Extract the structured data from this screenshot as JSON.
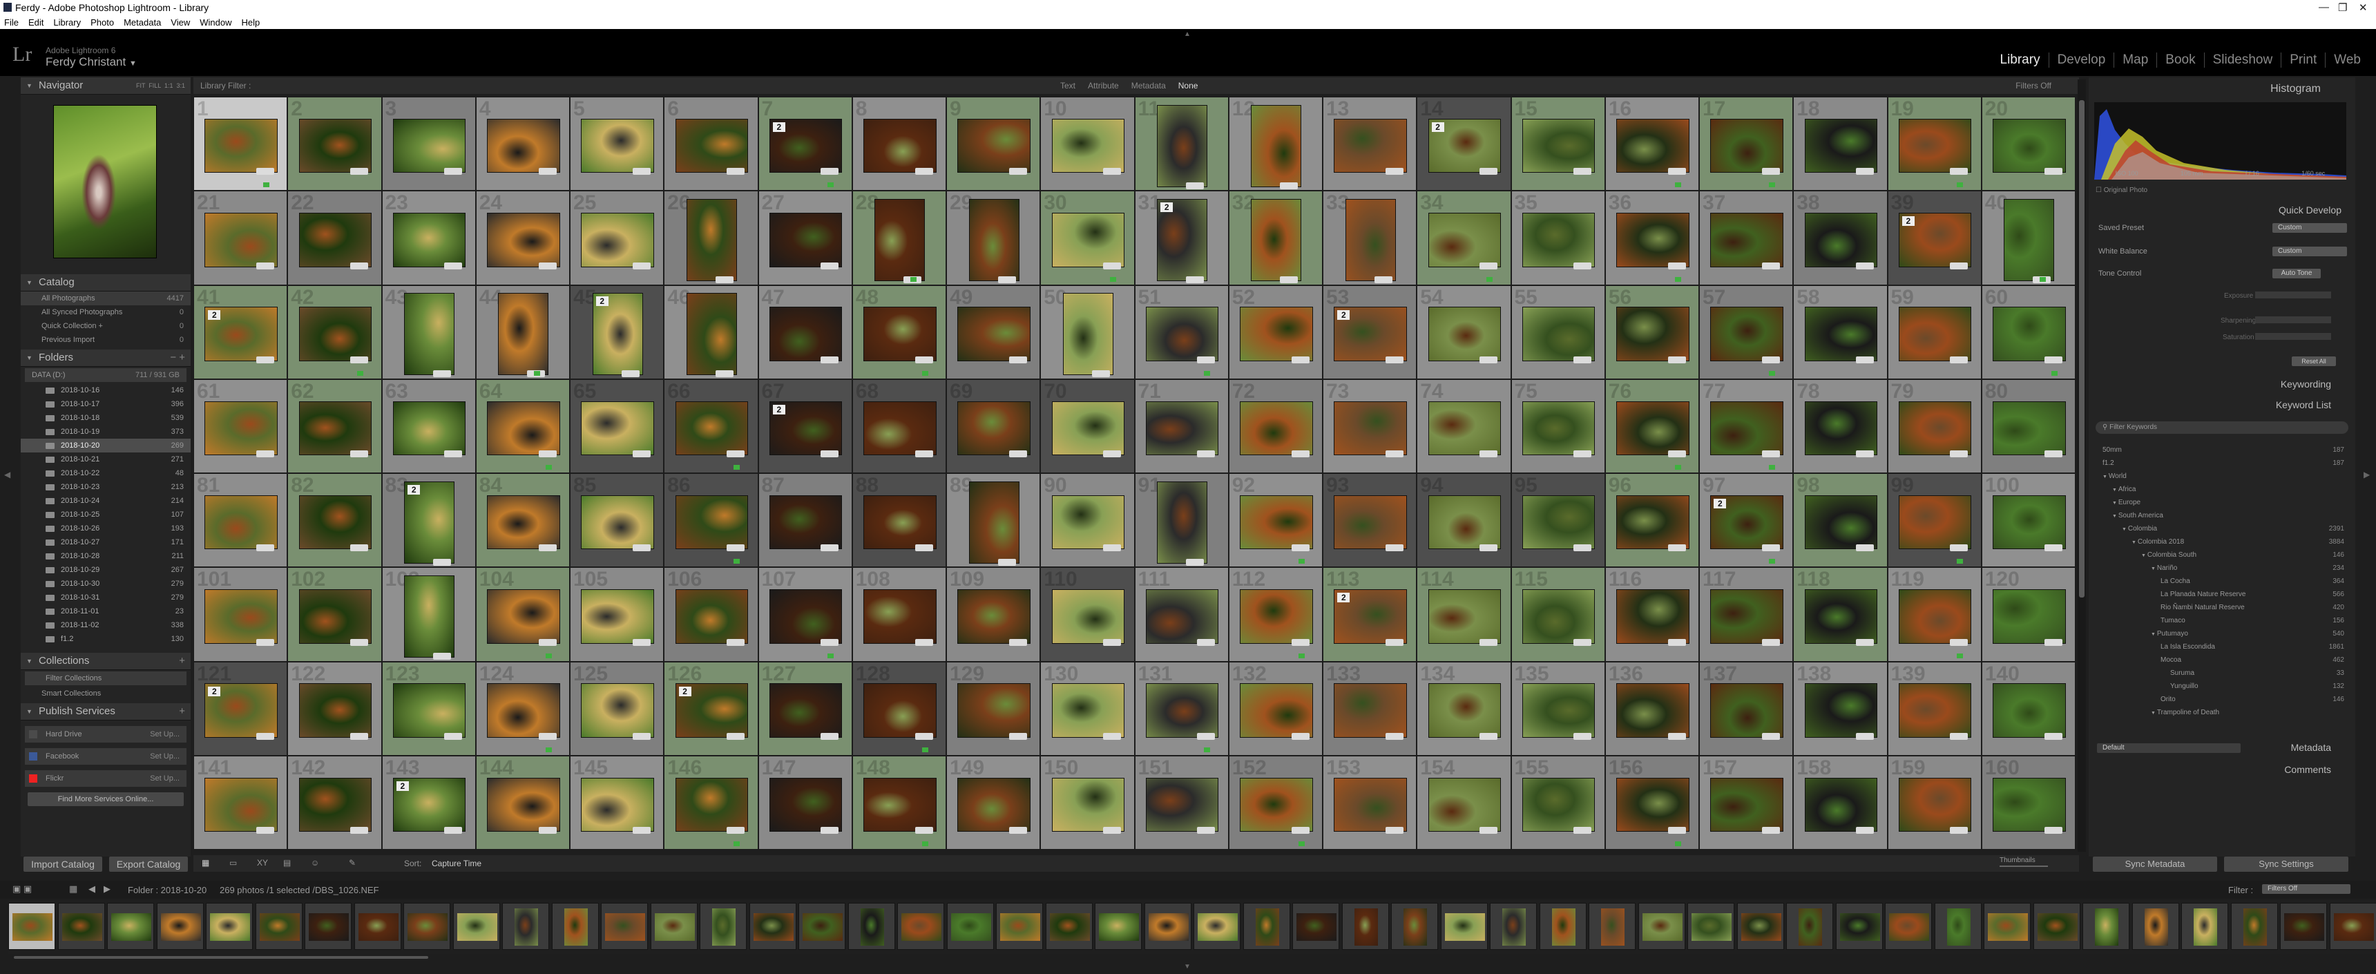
{
  "window": {
    "title": "Ferdy - Adobe Photoshop Lightroom - Library"
  },
  "menu": [
    "File",
    "Edit",
    "Library",
    "Photo",
    "Metadata",
    "View",
    "Window",
    "Help"
  ],
  "identity": {
    "product": "Adobe Lightroom 6",
    "user": "Ferdy Christant"
  },
  "modules": [
    "Library",
    "Develop",
    "Map",
    "Book",
    "Slideshow",
    "Print",
    "Web"
  ],
  "left": {
    "navigator": {
      "title": "Navigator",
      "zoom": [
        "FIT",
        "FILL",
        "1:1",
        "3:1"
      ]
    },
    "catalog": {
      "title": "Catalog",
      "items": [
        {
          "label": "All Photographs",
          "count": "4417"
        },
        {
          "label": "All Synced Photographs",
          "count": "0"
        },
        {
          "label": "Quick Collection +",
          "count": "0"
        },
        {
          "label": "Previous Import",
          "count": "0"
        }
      ]
    },
    "folders": {
      "title": "Folders",
      "volume": "DATA (D:)",
      "volume_info": "711 / 931 GB",
      "items": [
        {
          "label": "2018-10-16",
          "count": "146"
        },
        {
          "label": "2018-10-17",
          "count": "396"
        },
        {
          "label": "2018-10-18",
          "count": "539"
        },
        {
          "label": "2018-10-19",
          "count": "373"
        },
        {
          "label": "2018-10-20",
          "count": "269"
        },
        {
          "label": "2018-10-21",
          "count": "271"
        },
        {
          "label": "2018-10-22",
          "count": "48"
        },
        {
          "label": "2018-10-23",
          "count": "213"
        },
        {
          "label": "2018-10-24",
          "count": "214"
        },
        {
          "label": "2018-10-25",
          "count": "107"
        },
        {
          "label": "2018-10-26",
          "count": "193"
        },
        {
          "label": "2018-10-27",
          "count": "171"
        },
        {
          "label": "2018-10-28",
          "count": "211"
        },
        {
          "label": "2018-10-29",
          "count": "267"
        },
        {
          "label": "2018-10-30",
          "count": "279"
        },
        {
          "label": "2018-10-31",
          "count": "279"
        },
        {
          "label": "2018-11-01",
          "count": "23"
        },
        {
          "label": "2018-11-02",
          "count": "338"
        },
        {
          "label": "f1.2",
          "count": "130"
        }
      ]
    },
    "collections": {
      "title": "Collections",
      "items": [
        "Filter Collections",
        "Smart Collections"
      ]
    },
    "publish": {
      "title": "Publish Services",
      "items": [
        {
          "label": "Hard Drive",
          "action": "Set Up..."
        },
        {
          "label": "Facebook",
          "action": "Set Up..."
        },
        {
          "label": "Flickr",
          "action": "Set Up..."
        }
      ],
      "find_more": "Find More Services Online..."
    },
    "import_btn": "Import Catalog",
    "export_btn": "Export Catalog"
  },
  "filterbar": {
    "title": "Library Filter :",
    "tabs": [
      "Text",
      "Attribute",
      "Metadata",
      "None"
    ],
    "status": "Filters Off"
  },
  "grid": {
    "numbers": [
      "1",
      "2",
      "3",
      "4",
      "5",
      "6",
      "7",
      "8",
      "9",
      "10",
      "11",
      "12",
      "13",
      "14",
      "15",
      "16",
      "17",
      "18",
      "19",
      "20",
      "21",
      "22",
      "23",
      "24",
      "25",
      "26",
      "27",
      "28",
      "29",
      "30",
      "31",
      "32",
      "33",
      "34",
      "35",
      "36",
      "37",
      "38",
      "39",
      "40",
      "41",
      "42",
      "43",
      "44",
      "45",
      "46",
      "47",
      "48",
      "49",
      "50",
      "51",
      "52",
      "53",
      "54",
      "55",
      "56",
      "57",
      "58",
      "59",
      "60",
      "61",
      "62",
      "63",
      "64",
      "65",
      "66",
      "67",
      "68",
      "69",
      "70",
      "71",
      "72",
      "73",
      "74",
      "75",
      "76",
      "77",
      "78",
      "79",
      "80",
      "81",
      "82",
      "83",
      "84",
      "85",
      "86",
      "87",
      "88",
      "89",
      "90",
      "91",
      "92",
      "93",
      "94",
      "95",
      "96",
      "97",
      "98",
      "99",
      "100",
      "101",
      "102",
      "103",
      "104",
      "105",
      "106",
      "107",
      "108",
      "109",
      "110",
      "111",
      "112",
      "113",
      "114",
      "115",
      "116",
      "117",
      "118",
      "119",
      "120",
      "121",
      "122",
      "123",
      "124",
      "125",
      "126",
      "127",
      "128",
      "129",
      "130",
      "131",
      "132",
      "133",
      "134",
      "135",
      "136",
      "137",
      "138",
      "139",
      "140",
      "141",
      "142",
      "143",
      "144",
      "145",
      "146",
      "147",
      "148",
      "149",
      "150",
      "151",
      "152",
      "153",
      "154",
      "155",
      "156",
      "157",
      "158",
      "159",
      "160"
    ],
    "palette": [
      "#4a7a2a",
      "#6a8c3a",
      "#2f4a18",
      "#7a3f1a",
      "#a0521e",
      "#35501f",
      "#1a1a1a",
      "#5a6b2b",
      "#c07a2a",
      "#3d2010",
      "#88a055",
      "#6b4a2a",
      "#233015",
      "#9a4a1c",
      "#1f3a0e",
      "#c9b060",
      "#5a2a10",
      "#2b2b2b",
      "#7a8f4a",
      "#40601f"
    ]
  },
  "toolbar": {
    "sort_label": "Sort:",
    "sort_value": "Capture Time",
    "thumbs_label": "Thumbnails"
  },
  "right": {
    "histogram": {
      "title": "Histogram",
      "meta": [
        "ISO 100",
        "105 mm",
        "f / 16",
        "1/60 sec"
      ],
      "original": "Original Photo"
    },
    "quickdev": {
      "title": "Quick Develop",
      "saved_preset": "Saved Preset",
      "saved_value": "Custom",
      "wb": "White Balance",
      "wb_value": "Custom",
      "tone": "Tone Control",
      "auto_tone": "Auto Tone",
      "exposure": "Exposure",
      "sharpening": "Sharpening",
      "saturation": "Saturation",
      "reset": "Reset All"
    },
    "keywording": {
      "title": "Keywording"
    },
    "keywordlist": {
      "title": "Keyword List",
      "filter_placeholder": "Filter Keywords",
      "items": [
        {
          "label": "50mm",
          "count": "187",
          "indent": 0
        },
        {
          "label": "f1.2",
          "count": "187",
          "indent": 0
        },
        {
          "label": "World",
          "count": "",
          "indent": 0
        },
        {
          "label": "Africa",
          "count": "",
          "indent": 1
        },
        {
          "label": "Europe",
          "count": "",
          "indent": 1
        },
        {
          "label": "South America",
          "count": "",
          "indent": 1
        },
        {
          "label": "Colombia",
          "count": "2391",
          "indent": 2
        },
        {
          "label": "Colombia 2018",
          "count": "3884",
          "indent": 3
        },
        {
          "label": "Colombia South",
          "count": "146",
          "indent": 4
        },
        {
          "label": "Nariño",
          "count": "234",
          "indent": 5
        },
        {
          "label": "La Cocha",
          "count": "364",
          "indent": 6
        },
        {
          "label": "La Planada Nature Reserve",
          "count": "566",
          "indent": 6
        },
        {
          "label": "Rio Ñambi Natural Reserve",
          "count": "420",
          "indent": 6
        },
        {
          "label": "Tumaco",
          "count": "156",
          "indent": 6
        },
        {
          "label": "Putumayo",
          "count": "540",
          "indent": 5
        },
        {
          "label": "La Isla Escondida",
          "count": "1861",
          "indent": 6
        },
        {
          "label": "Mocoa",
          "count": "462",
          "indent": 6
        },
        {
          "label": "Suruma",
          "count": "33",
          "indent": 7
        },
        {
          "label": "Yunguillo",
          "count": "132",
          "indent": 7
        },
        {
          "label": "Orito",
          "count": "146",
          "indent": 6
        },
        {
          "label": "Trampoline of Death",
          "count": "",
          "indent": 5
        }
      ]
    },
    "metadata": {
      "title": "Metadata",
      "preset": "Default"
    },
    "comments": {
      "title": "Comments"
    },
    "sync_meta": "Sync Metadata",
    "sync_settings": "Sync Settings"
  },
  "filmstrip": {
    "folder": "Folder : 2018-10-20",
    "info": "269 photos /1 selected /DBS_1026.NEF",
    "filter_label": "Filter :",
    "filter_value": "Filters Off"
  }
}
